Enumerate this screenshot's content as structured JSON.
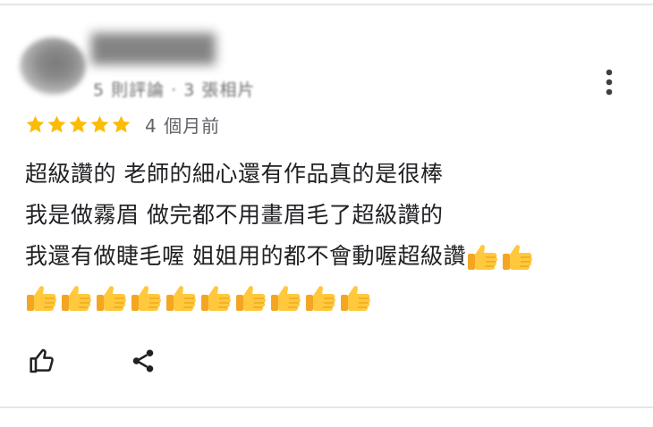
{
  "reviewer": {
    "name": "██████",
    "meta": "5 則評論 · 3 張相片",
    "avatar_icon": "avatar-blurred"
  },
  "rating": {
    "stars": 5,
    "max_stars": 5,
    "star_color": "#fbbc04",
    "date": "4 個月前"
  },
  "review": {
    "lines": [
      "超級讚的 老師的細心還有作品真的是很棒",
      "我是做霧眉 做完都不用畫眉毛了超級讚的",
      "我還有做睫毛喔 姐姐用的都不會動喔超級讚"
    ],
    "line3_emoji_count": 2,
    "line4_emoji_count": 10,
    "emoji_icon": "thumbs-up-icon"
  },
  "actions": {
    "like_icon": "thumbs-up-outline-icon",
    "share_icon": "share-icon",
    "more_icon": "more-vert-icon"
  }
}
